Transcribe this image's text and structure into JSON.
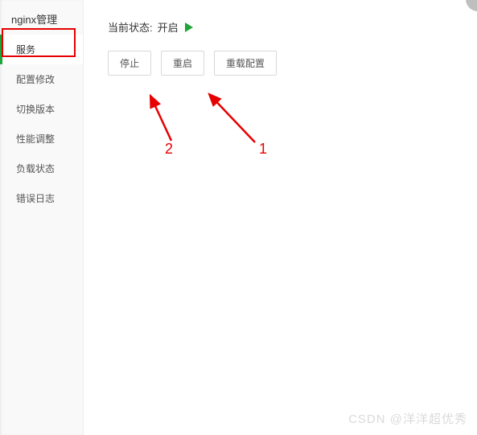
{
  "sidebar": {
    "title": "nginx管理",
    "items": [
      {
        "label": "服务",
        "active": true
      },
      {
        "label": "配置修改",
        "active": false
      },
      {
        "label": "切换版本",
        "active": false
      },
      {
        "label": "性能调整",
        "active": false
      },
      {
        "label": "负载状态",
        "active": false
      },
      {
        "label": "错误日志",
        "active": false
      }
    ]
  },
  "status": {
    "label": "当前状态:",
    "value": "开启",
    "running": true
  },
  "buttons": {
    "stop": "停止",
    "restart": "重启",
    "reload": "重载配置"
  },
  "annotations": {
    "arrow1_label": "1",
    "arrow2_label": "2"
  },
  "watermark": "CSDN @洋洋超优秀",
  "colors": {
    "accent_green": "#20a53a",
    "anno_red": "#e60000"
  }
}
